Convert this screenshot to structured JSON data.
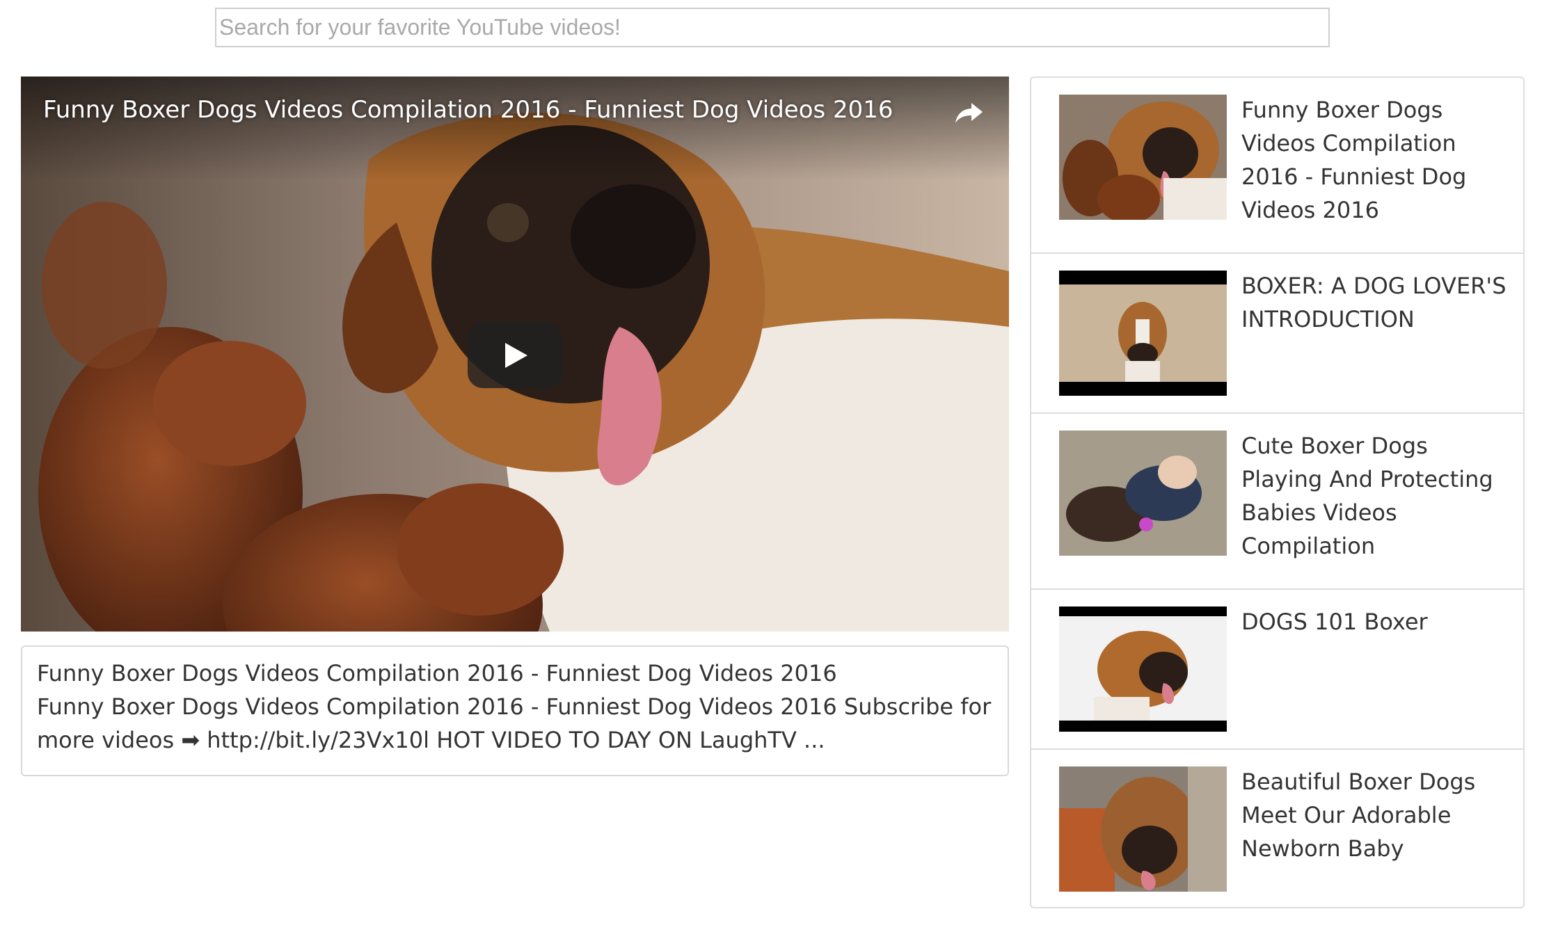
{
  "search": {
    "placeholder": "Search for your favorite YouTube videos!"
  },
  "player": {
    "title": "Funny Boxer Dogs Videos Compilation 2016 - Funniest Dog Videos 2016",
    "share_icon": "share-arrow-icon",
    "play_icon": "play-icon"
  },
  "details": {
    "title": "Funny Boxer Dogs Videos Compilation 2016 - Funniest Dog Videos 2016",
    "description": "Funny Boxer Dogs Videos Compilation 2016 - Funniest Dog Videos 2016 Subscribe for more videos ➡ http://bit.ly/23Vx10l HOT VIDEO TO DAY ON LaughTV ..."
  },
  "video_list": {
    "items": [
      {
        "title": "Funny Boxer Dogs Videos Compilation 2016 - Funniest Dog Videos 2016"
      },
      {
        "title": "BOXER: A DOG LOVER'S INTRODUCTION"
      },
      {
        "title": "Cute Boxer Dogs Playing And Protecting Babies Videos Compilation"
      },
      {
        "title": "DOGS 101 Boxer"
      },
      {
        "title": "Beautiful Boxer Dogs Meet Our Adorable Newborn Baby"
      }
    ]
  }
}
